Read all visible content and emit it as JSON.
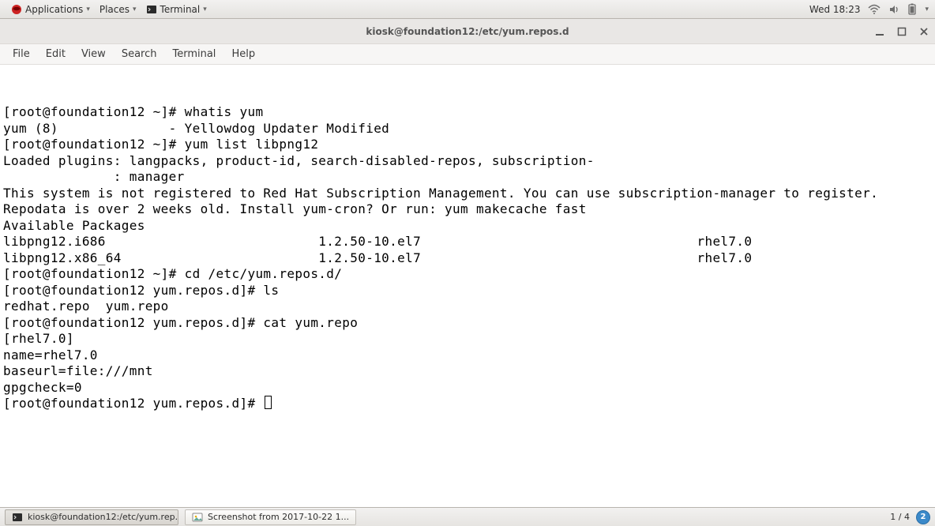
{
  "top_panel": {
    "applications": "Applications",
    "places": "Places",
    "running": "Terminal",
    "clock": "Wed 18:23"
  },
  "window": {
    "title": "kiosk@foundation12:/etc/yum.repos.d"
  },
  "menubar": {
    "file": "File",
    "edit": "Edit",
    "view": "View",
    "search": "Search",
    "terminal": "Terminal",
    "help": "Help"
  },
  "terminal_lines": [
    "[root@foundation12 ~]# whatis yum",
    "yum (8)              - Yellowdog Updater Modified",
    "[root@foundation12 ~]# yum list libpng12",
    "Loaded plugins: langpacks, product-id, search-disabled-repos, subscription-",
    "              : manager",
    "This system is not registered to Red Hat Subscription Management. You can use subscription-manager to register.",
    "Repodata is over 2 weeks old. Install yum-cron? Or run: yum makecache fast",
    "Available Packages",
    "libpng12.i686                           1.2.50-10.el7                                   rhel7.0",
    "libpng12.x86_64                         1.2.50-10.el7                                   rhel7.0",
    "[root@foundation12 ~]# cd /etc/yum.repos.d/",
    "[root@foundation12 yum.repos.d]# ls",
    "redhat.repo  yum.repo",
    "[root@foundation12 yum.repos.d]# cat yum.repo",
    "[rhel7.0]",
    "name=rhel7.0",
    "baseurl=file:///mnt",
    "gpgcheck=0"
  ],
  "terminal_prompt": "[root@foundation12 yum.repos.d]# ",
  "taskbar": {
    "task1": "kiosk@foundation12:/etc/yum.rep...",
    "task2": "Screenshot from 2017-10-22 1...",
    "workspaces": "1 / 4",
    "badge": "2"
  }
}
